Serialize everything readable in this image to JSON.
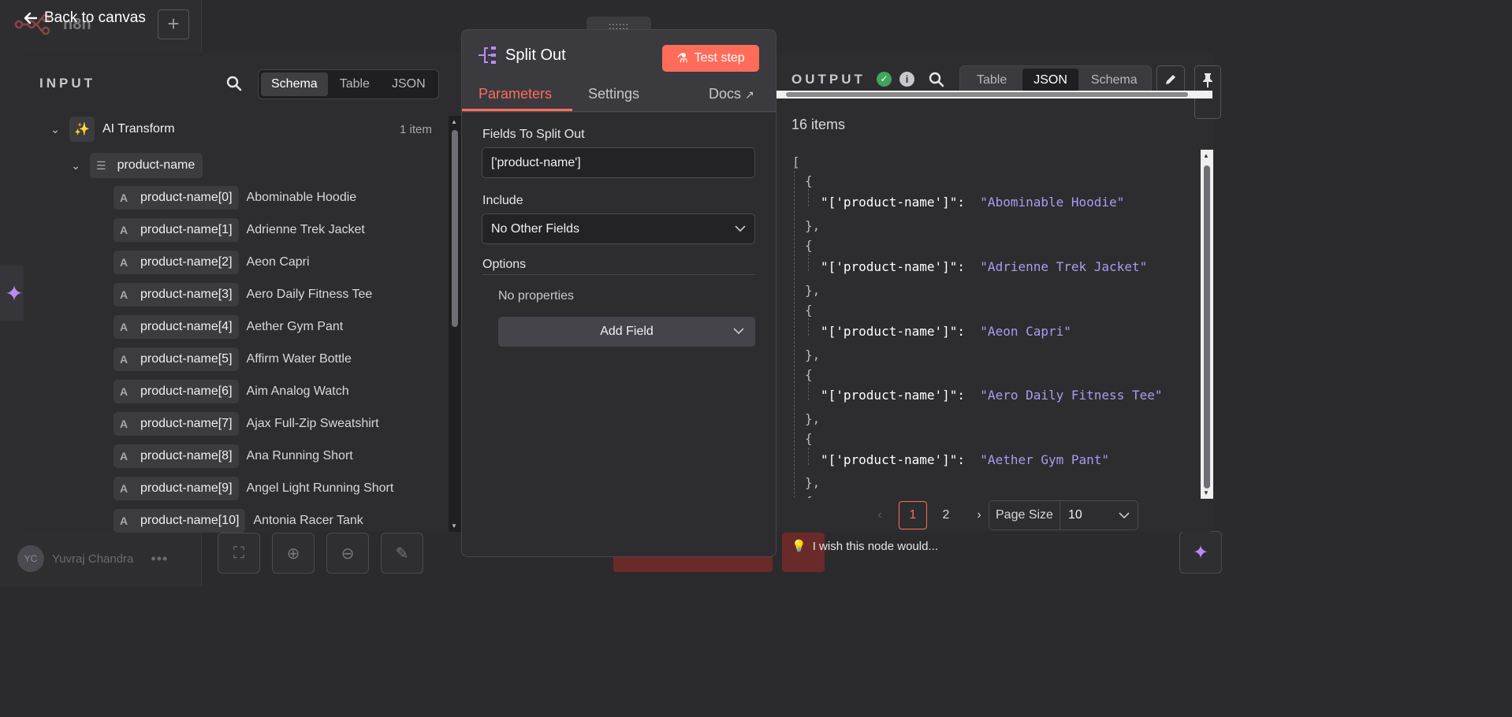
{
  "nav": {
    "back_label": "Back to canvas",
    "app_name": "n8n"
  },
  "user": {
    "initials": "YC",
    "name": "Yuvraj Chandra",
    "more": "•••"
  },
  "input": {
    "title": "INPUT",
    "views": [
      "Schema",
      "Table",
      "JSON"
    ],
    "active_view": "Schema",
    "root_node": {
      "label": "AI Transform",
      "count": "1 item"
    },
    "field": "product-name",
    "items": [
      {
        "key": "product-name[0]",
        "value": "Abominable Hoodie"
      },
      {
        "key": "product-name[1]",
        "value": "Adrienne Trek Jacket"
      },
      {
        "key": "product-name[2]",
        "value": "Aeon Capri"
      },
      {
        "key": "product-name[3]",
        "value": "Aero Daily Fitness Tee"
      },
      {
        "key": "product-name[4]",
        "value": "Aether Gym Pant"
      },
      {
        "key": "product-name[5]",
        "value": "Affirm Water Bottle"
      },
      {
        "key": "product-name[6]",
        "value": "Aim Analog Watch"
      },
      {
        "key": "product-name[7]",
        "value": "Ajax Full-Zip Sweatshirt"
      },
      {
        "key": "product-name[8]",
        "value": "Ana Running Short"
      },
      {
        "key": "product-name[9]",
        "value": "Angel Light Running Short"
      },
      {
        "key": "product-name[10]",
        "value": "Antonia Racer Tank"
      }
    ],
    "type_glyph": "A"
  },
  "node": {
    "title": "Split Out",
    "test_label": "Test step",
    "tabs": {
      "parameters": "Parameters",
      "settings": "Settings",
      "docs": "Docs"
    },
    "fields_label": "Fields To Split Out",
    "fields_value": "['product-name']",
    "include_label": "Include",
    "include_value": "No Other Fields",
    "options_label": "Options",
    "no_props": "No properties",
    "add_field": "Add Field"
  },
  "output": {
    "title": "OUTPUT",
    "views": [
      "Table",
      "JSON",
      "Schema"
    ],
    "active_view": "JSON",
    "items_count": "16 items",
    "json_key": "\"['product-name']\":",
    "json_values": [
      "\"Abominable Hoodie\"",
      "\"Adrienne Trek Jacket\"",
      "\"Aeon Capri\"",
      "\"Aero Daily Fitness Tee\"",
      "\"Aether Gym Pant\""
    ],
    "pages": [
      "1",
      "2"
    ],
    "active_page": "1",
    "page_size_label": "Page Size",
    "page_size_value": "10"
  },
  "footer": {
    "wish": "I wish this node would..."
  },
  "colors": {
    "accent": "#ff6d5a",
    "ai_purple": "#b78cf5",
    "success": "#3fa55b",
    "json_string": "#a79cf0"
  }
}
